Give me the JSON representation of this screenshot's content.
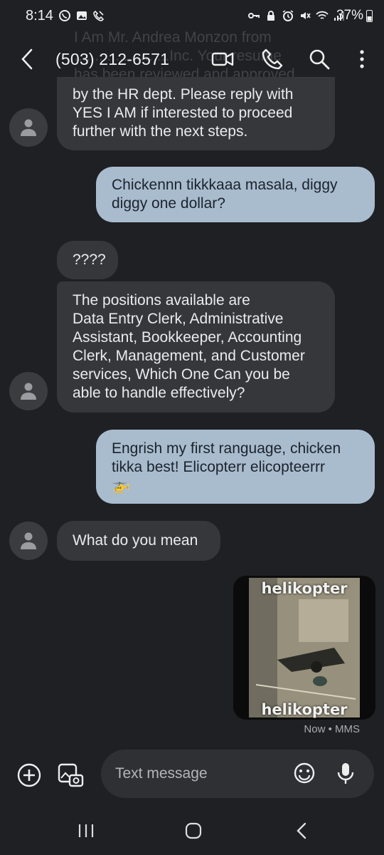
{
  "status_bar": {
    "time": "8:14",
    "battery_percent": "37%"
  },
  "header": {
    "title": "(503) 212-6571",
    "scrolled_preview": "I Am Mr. Andrea Monzon from\n.......................Inc. Your resume\nhas been reviewed and approved"
  },
  "messages": [
    {
      "direction": "incoming",
      "text": "by the HR dept. Please reply with\nYES I AM if interested to proceed\nfurther with the next steps."
    },
    {
      "direction": "outgoing",
      "text": "Chickennn tikkkaaa masala, diggy\ndiggy one dollar?"
    },
    {
      "direction": "incoming",
      "text": "????"
    },
    {
      "direction": "incoming",
      "text": "The positions available are\nData Entry Clerk, Administrative\nAssistant, Bookkeeper, Accounting\nClerk, Management, and Customer\nservices, Which One Can you be\nable to handle effectively?"
    },
    {
      "direction": "outgoing",
      "text": "Engrish my first ranguage, chicken\ntikka best! Elicopterr elicopteerrr\n🚁"
    },
    {
      "direction": "incoming",
      "text": "What do you mean"
    }
  ],
  "mms": {
    "caption_top": "helikopter",
    "caption_bottom": "helikopter",
    "meta": "Now • MMS"
  },
  "composer": {
    "placeholder": "Text message"
  },
  "icons": {
    "back": "chevron-left-icon",
    "video": "video-call-icon",
    "phone": "phone-icon",
    "search": "search-icon",
    "more": "more-vertical-icon",
    "add": "add-circle-icon",
    "gallery": "gallery-icon",
    "emoji": "emoji-icon",
    "mic": "mic-icon"
  },
  "colors": {
    "background": "#1f2024",
    "incoming_bubble": "#35373b",
    "outgoing_bubble": "#a9bcce"
  }
}
